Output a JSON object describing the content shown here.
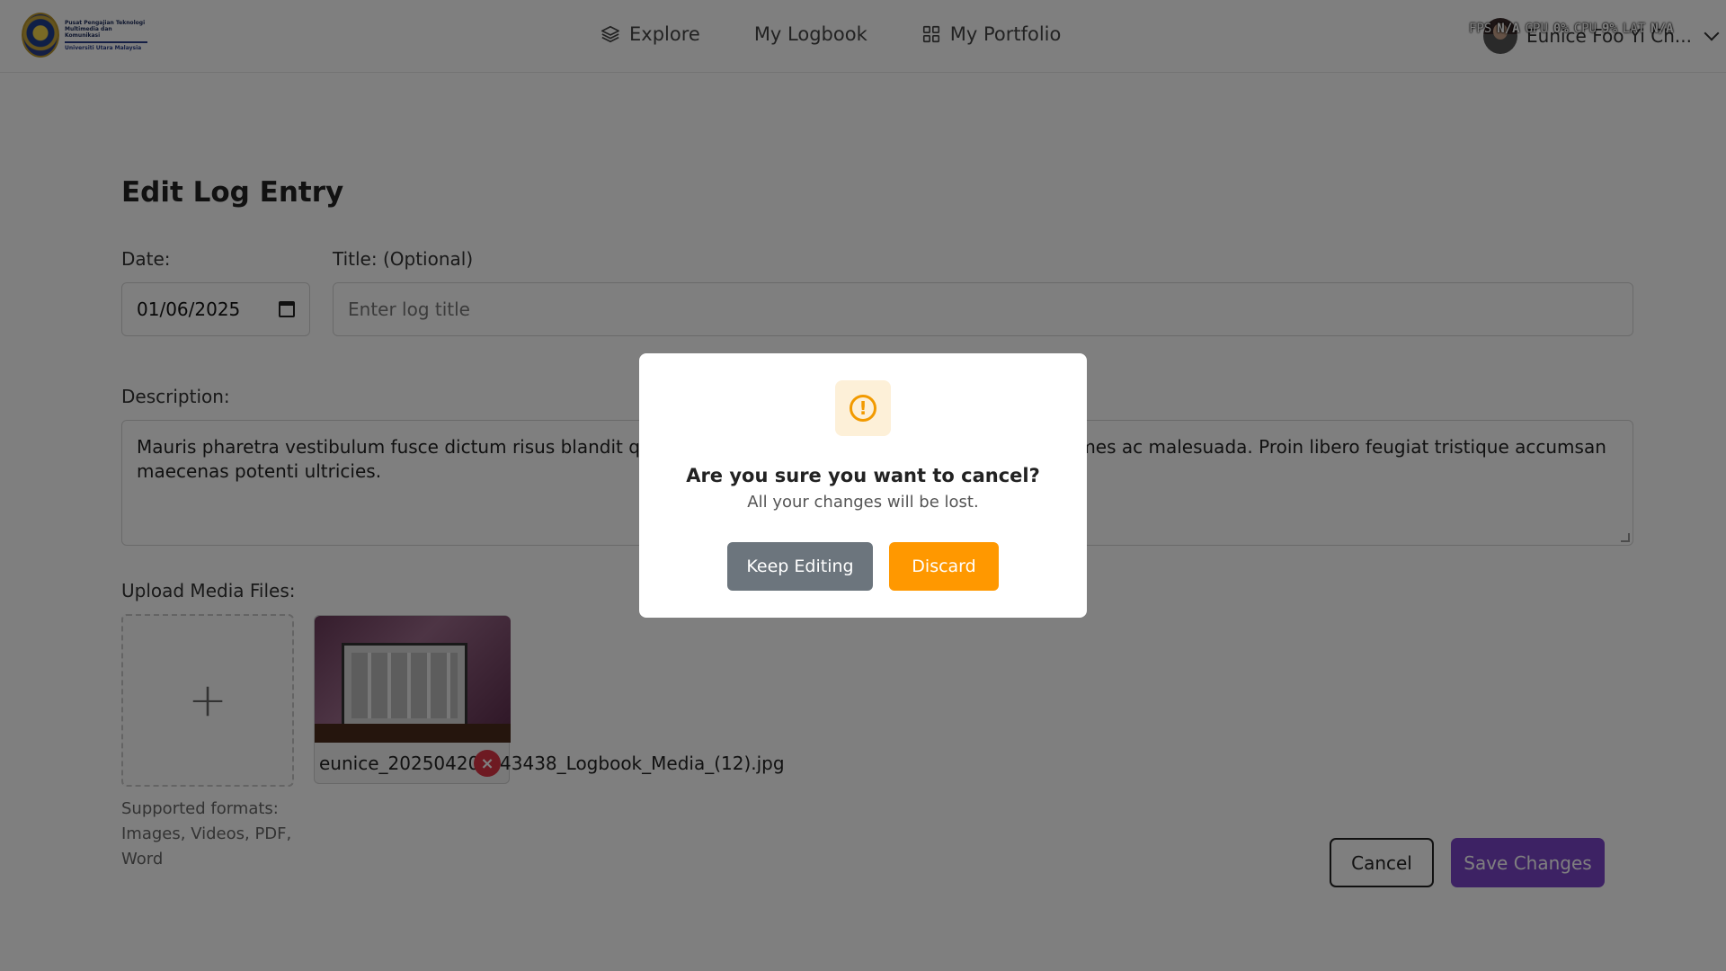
{
  "header": {
    "logo": {
      "line1": "Pusat Pengajian Teknologi",
      "line2": "Multimedia dan Komunikasi",
      "line3": "Universiti Utara Malaysia"
    },
    "nav": [
      {
        "label": "Explore",
        "icon": "layers-icon"
      },
      {
        "label": "My Logbook",
        "icon": ""
      },
      {
        "label": "My Portfolio",
        "icon": "grid-icon"
      }
    ],
    "user": {
      "name": "Eunice Foo Yi Ch..."
    },
    "perf_overlay": {
      "fps_label": "FPS",
      "fps_value": "N/A",
      "gpu_label": "GPU",
      "gpu_value": "0%",
      "cpu_label": "CPU",
      "cpu_value": "9%",
      "lat_label": "LAT",
      "lat_value": "N/A"
    }
  },
  "form": {
    "page_title": "Edit Log Entry",
    "date_label": "Date:",
    "date_value": "01/06/2025",
    "title_label": "Title: (Optional)",
    "title_placeholder": "Enter log title",
    "title_value": "",
    "description_label": "Description:",
    "description_value": "Mauris pharetra vestibulum fusce dictum risus blandit quis. Ultrices lacinia a tempor porta malesuada fames ac malesuada. Proin libero feugiat tristique accumsan maecenas potenti ultricies.",
    "upload_label": "Upload Media Files:",
    "upload_plus": "+",
    "supported_formats": "Supported formats: Images, Videos, PDF, Word",
    "media_files": [
      {
        "name": "eunice_20250420_143438_Logbook_Media_(12).jpg",
        "remove": "×"
      }
    ],
    "cancel_label": "Cancel",
    "save_label": "Save Changes"
  },
  "modal": {
    "icon": "exclamation-circle-icon",
    "icon_glyph": "!",
    "title": "Are you sure you want to cancel?",
    "subtitle": "All your changes will be lost.",
    "keep_label": "Keep Editing",
    "discard_label": "Discard"
  },
  "colors": {
    "accent_purple": "#7b45c9",
    "discard_orange": "#ff9800",
    "keep_gray": "#6c757d",
    "remove_red": "#dc3545"
  }
}
